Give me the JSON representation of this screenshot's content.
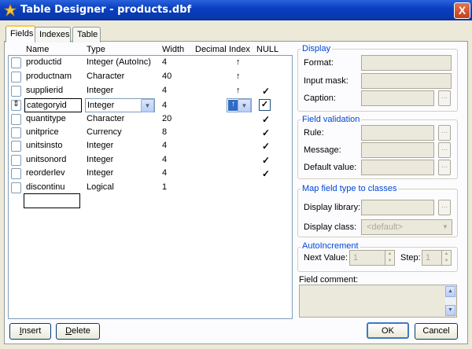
{
  "window": {
    "title": "Table Designer - products.dbf",
    "close_label": "X"
  },
  "tabs": [
    {
      "label": "Fields"
    },
    {
      "label": "Indexes"
    },
    {
      "label": "Table"
    }
  ],
  "grid": {
    "headers": {
      "name": "Name",
      "type": "Type",
      "width": "Width",
      "decimal": "Decimal",
      "index": "Index",
      "null": "NULL"
    },
    "rows": [
      {
        "name": "productid",
        "type": "Integer (AutoInc)",
        "width": "4",
        "index": "↑",
        "null": ""
      },
      {
        "name": "productnam",
        "type": "Character",
        "width": "40",
        "index": "↑",
        "null": ""
      },
      {
        "name": "supplierid",
        "type": "Integer",
        "width": "4",
        "index": "↑",
        "null": "✓"
      },
      {
        "name": "categoryid",
        "type": "Integer",
        "width": "4",
        "index": "↑",
        "null": "✓"
      },
      {
        "name": "quantitype",
        "type": "Character",
        "width": "20",
        "index": "",
        "null": "✓"
      },
      {
        "name": "unitprice",
        "type": "Currency",
        "width": "8",
        "index": "",
        "null": "✓"
      },
      {
        "name": "unitsinsto",
        "type": "Integer",
        "width": "4",
        "index": "",
        "null": "✓"
      },
      {
        "name": "unitsonord",
        "type": "Integer",
        "width": "4",
        "index": "",
        "null": "✓"
      },
      {
        "name": "reorderlev",
        "type": "Integer",
        "width": "4",
        "index": "",
        "null": "✓"
      },
      {
        "name": "discontinu",
        "type": "Logical",
        "width": "1",
        "index": "",
        "null": ""
      }
    ],
    "new_field_value": ""
  },
  "display": {
    "title": "Display",
    "format_label": "Format:",
    "format_value": "",
    "input_mask_label": "Input mask:",
    "input_mask_value": "",
    "caption_label": "Caption:",
    "caption_value": ""
  },
  "validation": {
    "title": "Field validation",
    "rule_label": "Rule:",
    "rule_value": "",
    "message_label": "Message:",
    "message_value": "",
    "default_label": "Default value:",
    "default_value": ""
  },
  "map": {
    "title": "Map field type to classes",
    "library_label": "Display library:",
    "library_value": "",
    "class_label": "Display class:",
    "class_value": "<default>"
  },
  "autoinc": {
    "title": "AutoIncrement",
    "next_label": "Next Value:",
    "next_value": "1",
    "step_label": "Step:",
    "step_value": "1"
  },
  "comment": {
    "label": "Field comment:",
    "value": ""
  },
  "buttons": {
    "insert": "Insert",
    "delete": "Delete",
    "ok": "OK",
    "cancel": "Cancel",
    "ellipsis": "..."
  },
  "colors": {
    "titlebar": "#0a3fbf",
    "group_title": "#0046d5",
    "tab_highlight": "#ffc83c"
  }
}
